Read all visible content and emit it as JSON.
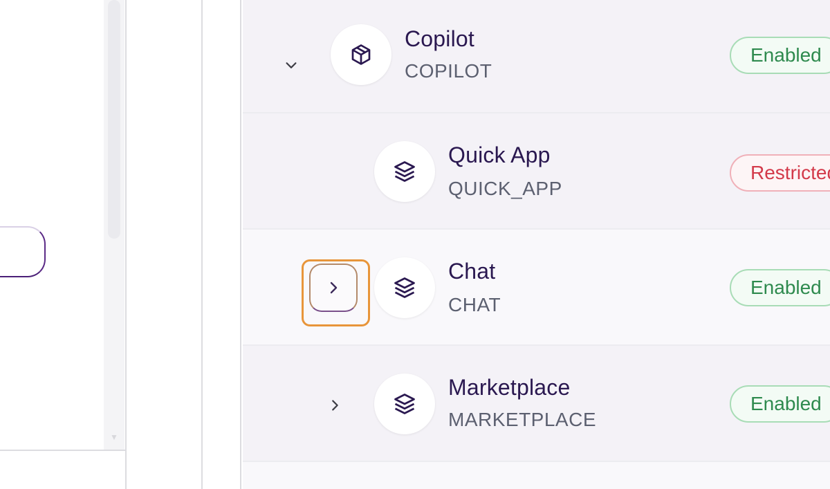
{
  "rows": [
    {
      "name": "Copilot",
      "code": "COPILOT",
      "status": "Enabled",
      "expanded": true
    },
    {
      "name": "Quick App",
      "code": "QUICK_APP",
      "status": "Restricted"
    },
    {
      "name": "Chat",
      "code": "CHAT",
      "status": "Enabled"
    },
    {
      "name": "Marketplace",
      "code": "MARKETPLACE",
      "status": "Enabled"
    }
  ],
  "icons": {
    "copilot": "package-icon",
    "child": "layers-icon",
    "expand": "chevron-right-icon",
    "collapse": "chevron-down-icon"
  },
  "colors": {
    "enabled": "#2e8a4e",
    "restricted": "#d33a4a",
    "focus": "#e8953a",
    "accent": "#4a1f77"
  }
}
